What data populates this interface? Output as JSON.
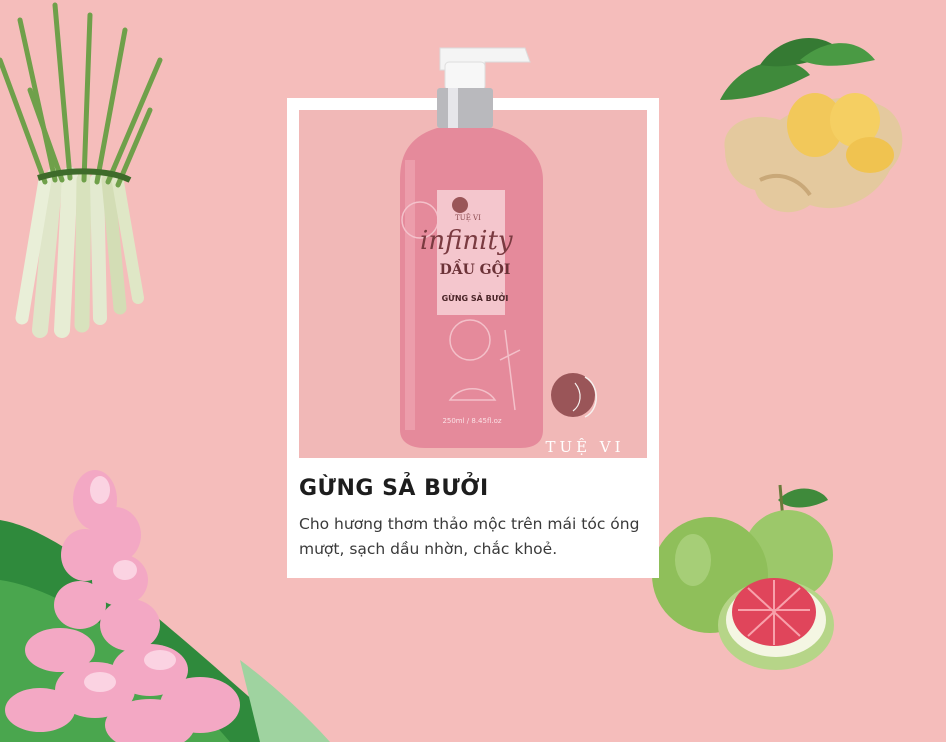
{
  "product": {
    "brand": "TUỆ VI",
    "brand_mark": "TUỆ VI",
    "line_name": "infinity",
    "type": "DẦU GỘI",
    "variant": "GỪNG SẢ BƯỞI",
    "volume": "250ml / 8.45fl.oz"
  },
  "card": {
    "title": "GỪNG SẢ BƯỞI",
    "description": "Cho hương thơm thảo mộc trên mái tóc óng mượt, sạch dầu nhờn, chắc khoẻ."
  },
  "decorations": [
    "lemongrass-bundle",
    "ginger-root",
    "torch-ginger-flower",
    "pomelo-fruits"
  ],
  "colors": {
    "background": "#f5bdbb",
    "bottle": "#e58a9b",
    "card": "#ffffff",
    "logo": "#9a5558"
  }
}
